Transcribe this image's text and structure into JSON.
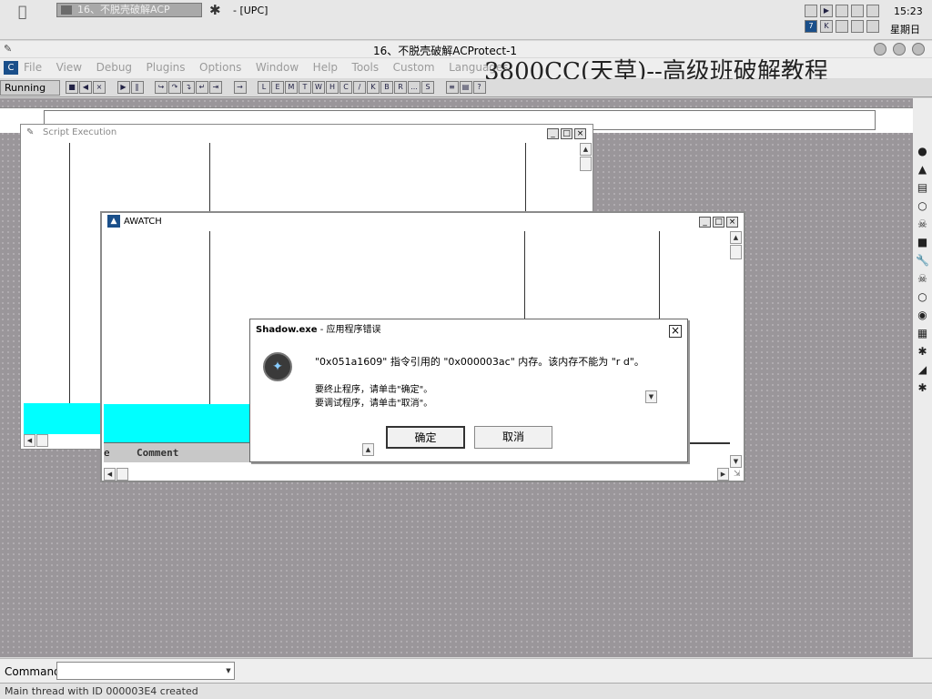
{
  "topbar": {
    "apple": "",
    "task_label": "16、不脱壳破解ACP",
    "upc_label": "- [UPC]",
    "clock": "15:23",
    "weekday": "星期日"
  },
  "app": {
    "window_title": "16、不脱壳破解ACProtect-1",
    "menu": [
      "File",
      "View",
      "Debug",
      "Plugins",
      "Options",
      "Window",
      "Help",
      "Tools",
      "Custom",
      "Languages"
    ],
    "watermark": "3800CC(天草)--高级班破解教程",
    "status": "Running",
    "toolbar_letters": [
      "L",
      "E",
      "M",
      "T",
      "W",
      "H",
      "C",
      "/",
      "K",
      "B",
      "R",
      "...",
      "S"
    ]
  },
  "script_window": {
    "title": "Script Execution"
  },
  "awatch_window": {
    "title": "AWATCH",
    "col_left": "e",
    "col_comment": "Comment"
  },
  "dialog": {
    "title_bold": "Shadow.exe",
    "title_rest": " - 应用程序错误",
    "message": "\"0x051a1609\" 指令引用的 \"0x000003ac\" 内存。该内存不能为 \"r    d\"。",
    "line2": "要终止程序，请单击\"确定\"。",
    "line3": "要调试程序，请单击\"取消\"。",
    "ok": "确定",
    "cancel": "取消"
  },
  "command": {
    "label": "Command",
    "value": ""
  },
  "statusbar": {
    "text": "Main thread with ID 000003E4 created"
  },
  "colors": {
    "cyan": "#00ffff",
    "accent": "#1a4f8a"
  }
}
